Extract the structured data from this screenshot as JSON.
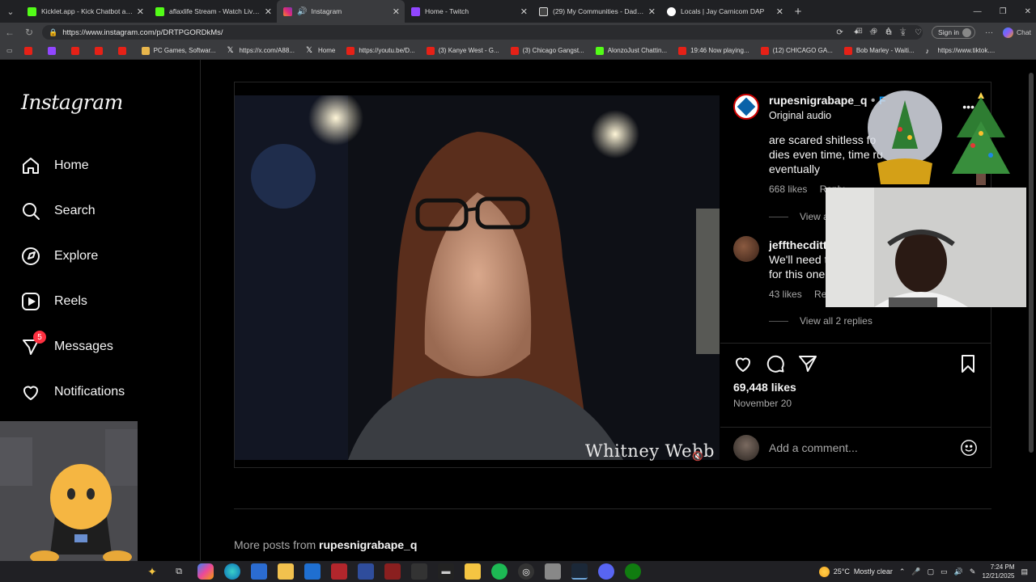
{
  "browser": {
    "tabs": [
      {
        "title": "Kicklet.app - Kick Chatbot and Ov",
        "color": "#53fc18"
      },
      {
        "title": "aflaxlife Stream - Watch Live on Ki",
        "color": "#53fc18"
      },
      {
        "title": "Instagram",
        "color": "#e1306c",
        "active": true
      },
      {
        "title": "Home - Twitch",
        "color": "#9146ff"
      },
      {
        "title": "(29) My Communities - Dads Agai",
        "color": "#ffffff"
      },
      {
        "title": "Locals | Jay Carnicom DAP",
        "color": "#ffffff"
      }
    ],
    "url": "https://www.instagram.com/p/DRTPGORDkMs/",
    "signin_label": "Sign in",
    "chat_label": "Chat",
    "bookmarks": [
      {
        "label": "",
        "icon": "youtube"
      },
      {
        "label": "",
        "icon": "twitch"
      },
      {
        "label": "",
        "icon": "youtube"
      },
      {
        "label": "",
        "icon": "youtube"
      },
      {
        "label": "",
        "icon": "youtube"
      },
      {
        "label": "PC Games, Softwar...",
        "icon": "folder"
      },
      {
        "label": "https://x.com/A88...",
        "icon": "x"
      },
      {
        "label": "Home",
        "icon": "x"
      },
      {
        "label": "https://youtu.be/D...",
        "icon": "youtube"
      },
      {
        "label": "(3) Kanye West - G...",
        "icon": "youtube"
      },
      {
        "label": "(3) Chicago Gangst...",
        "icon": "youtube"
      },
      {
        "label": "AlonzoJust Chattin...",
        "icon": "kick"
      },
      {
        "label": "19:46 Now playing...",
        "icon": "youtube"
      },
      {
        "label": "(12) CHICAGO GA...",
        "icon": "youtube"
      },
      {
        "label": "Bob Marley - Waiti...",
        "icon": "youtube"
      },
      {
        "label": "https://www.tiktok....",
        "icon": "tiktok"
      }
    ]
  },
  "sidebar": {
    "logo": "Instagram",
    "items": [
      {
        "label": "Home",
        "icon": "home-icon"
      },
      {
        "label": "Search",
        "icon": "search-icon"
      },
      {
        "label": "Explore",
        "icon": "compass-icon"
      },
      {
        "label": "Reels",
        "icon": "reels-icon"
      },
      {
        "label": "Messages",
        "icon": "messenger-icon",
        "badge": "5"
      },
      {
        "label": "Notifications",
        "icon": "heart-icon"
      }
    ]
  },
  "post": {
    "video_watermark": "Whitney Webb",
    "username": "rupesnigrabape_q",
    "follow": "F",
    "audio": "Original audio",
    "comments": [
      {
        "text_lines": [
          "are scared shitless fo",
          "dies even time, time ru",
          "eventually"
        ],
        "likes": "668 likes",
        "reply": "Reply",
        "view_replies": "View a"
      },
      {
        "username": "jeffthecditte",
        "text_lines": [
          "We'll need t",
          "for this one"
        ],
        "likes": "43 likes",
        "reply": "Rep",
        "view_replies": "View all 2 replies"
      }
    ],
    "likes": "69,448 likes",
    "date": "November 20",
    "add_comment_placeholder": "Add a comment..."
  },
  "more_posts": {
    "prefix": "More posts from",
    "username": "rupesnigrabape_q"
  },
  "taskbar": {
    "weather": "25°C",
    "weather_desc": "Mostly clear",
    "time": "7:24 PM",
    "date": "12/21/2025"
  }
}
